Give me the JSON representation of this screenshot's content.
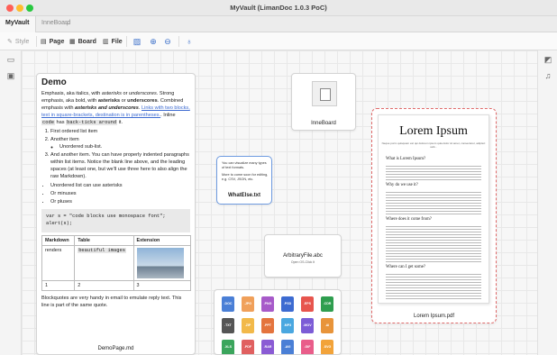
{
  "window": {
    "title": "MyVault (LimanDoc 1.0.3 PoC)"
  },
  "tabs": [
    {
      "label": "MyVault"
    },
    {
      "label": "InneBoard"
    }
  ],
  "tab_add": "+",
  "toolbar": {
    "style": "Style",
    "page": "Page",
    "board": "Board",
    "file": "File"
  },
  "demo": {
    "title": "Demo",
    "p1_a": "Emphasis, aka italics, with ",
    "p1_b": "asterisks",
    "p1_c": " or ",
    "p1_d": "underscores",
    "p1_e": ". Strong emphasis, aka bold, with ",
    "p1_f": "asterisks",
    "p1_g": " or ",
    "p1_h": "underscores",
    "p1_i": ". Combined emphasis with ",
    "p1_j": "asterisks and underscores",
    "p1_k": ". ",
    "p1_link": "Links with two blocks, text in square-brackets, destination is in parentheses.",
    "p1_l": ". Inline ",
    "p1_code1": "code",
    "p1_m": " has ",
    "p1_code2": "back-ticks around",
    "p1_n": " it.",
    "list": {
      "item1": "First ordered list item",
      "item2": "Another item",
      "sub1": "Unordered sub-list.",
      "item3": "And another item. You can have properly indented paragraphs within list items. Notice the blank line above, and the leading spaces (at least one, but we'll use three here to also align the raw Markdown).",
      "u1": "Unordered list can use asterisks",
      "u2": "Or minuses",
      "u3": "Or pluses"
    },
    "code_line1": "var s = \"code blocks use monospace font\";",
    "code_line2": "alert(s);",
    "table": {
      "headers": [
        "Markdown",
        "Table",
        "Extension"
      ],
      "row1": [
        "renders",
        "beautiful images",
        ""
      ],
      "row2": [
        "1",
        "2",
        "3"
      ]
    },
    "quote": "Blockquotes are very handy in email to emulate reply text. This line is part of the same quote.",
    "caption": "DemoPage.md"
  },
  "inneboard": {
    "caption": "InneBoard"
  },
  "whatelse": {
    "line1": "You can visualize many types of text formats.",
    "line2": "More to come soon for editing, e.g. CSV, JSON, etc.",
    "caption": "WhatElse.txt"
  },
  "arbitrary": {
    "caption": "ArbitraryFile.abc",
    "sub": "Open OS-Click It"
  },
  "file_icons": [
    {
      "label": ".DOC",
      "color": "#4a7fd6"
    },
    {
      "label": ".JPG",
      "color": "#f0a05a"
    },
    {
      "label": ".PNG",
      "color": "#a75ac9"
    },
    {
      "label": ".PSD",
      "color": "#3d6bd1"
    },
    {
      "label": ".EPS",
      "color": "#e7554e"
    },
    {
      "label": ".CDR",
      "color": "#2f9e4f"
    },
    {
      "label": ".TXT",
      "color": "#555555"
    },
    {
      "label": ".ZIP",
      "color": "#f2b94a"
    },
    {
      "label": ".PPT",
      "color": "#e4743e"
    },
    {
      "label": ".MP3",
      "color": "#4aa7e0"
    },
    {
      "label": ".MOV",
      "color": "#7c5cd6"
    },
    {
      "label": ".AI",
      "color": "#e8943a"
    },
    {
      "label": ".XLS",
      "color": "#3ba55c"
    },
    {
      "label": ".PDF",
      "color": "#e06060"
    },
    {
      "label": ".RAR",
      "color": "#8a5bd4"
    },
    {
      "label": ".AVI",
      "color": "#4a7fd6"
    },
    {
      "label": ".GIF",
      "color": "#e95d8a"
    },
    {
      "label": ".SVG",
      "color": "#f2a33a"
    }
  ],
  "pdf": {
    "title": "Lorem Ipsum",
    "sub": "Neque porro quisquam est qui dolorem ipsum quia dolor sit amet, consectetur, adipisci velit...",
    "h_what": "What is Lorem Ipsum?",
    "h_why": "Why do we use it?",
    "h_where": "Where does it come from?",
    "h_get": "Where can I get some?",
    "caption": "Lorem Ipsum.pdf"
  }
}
